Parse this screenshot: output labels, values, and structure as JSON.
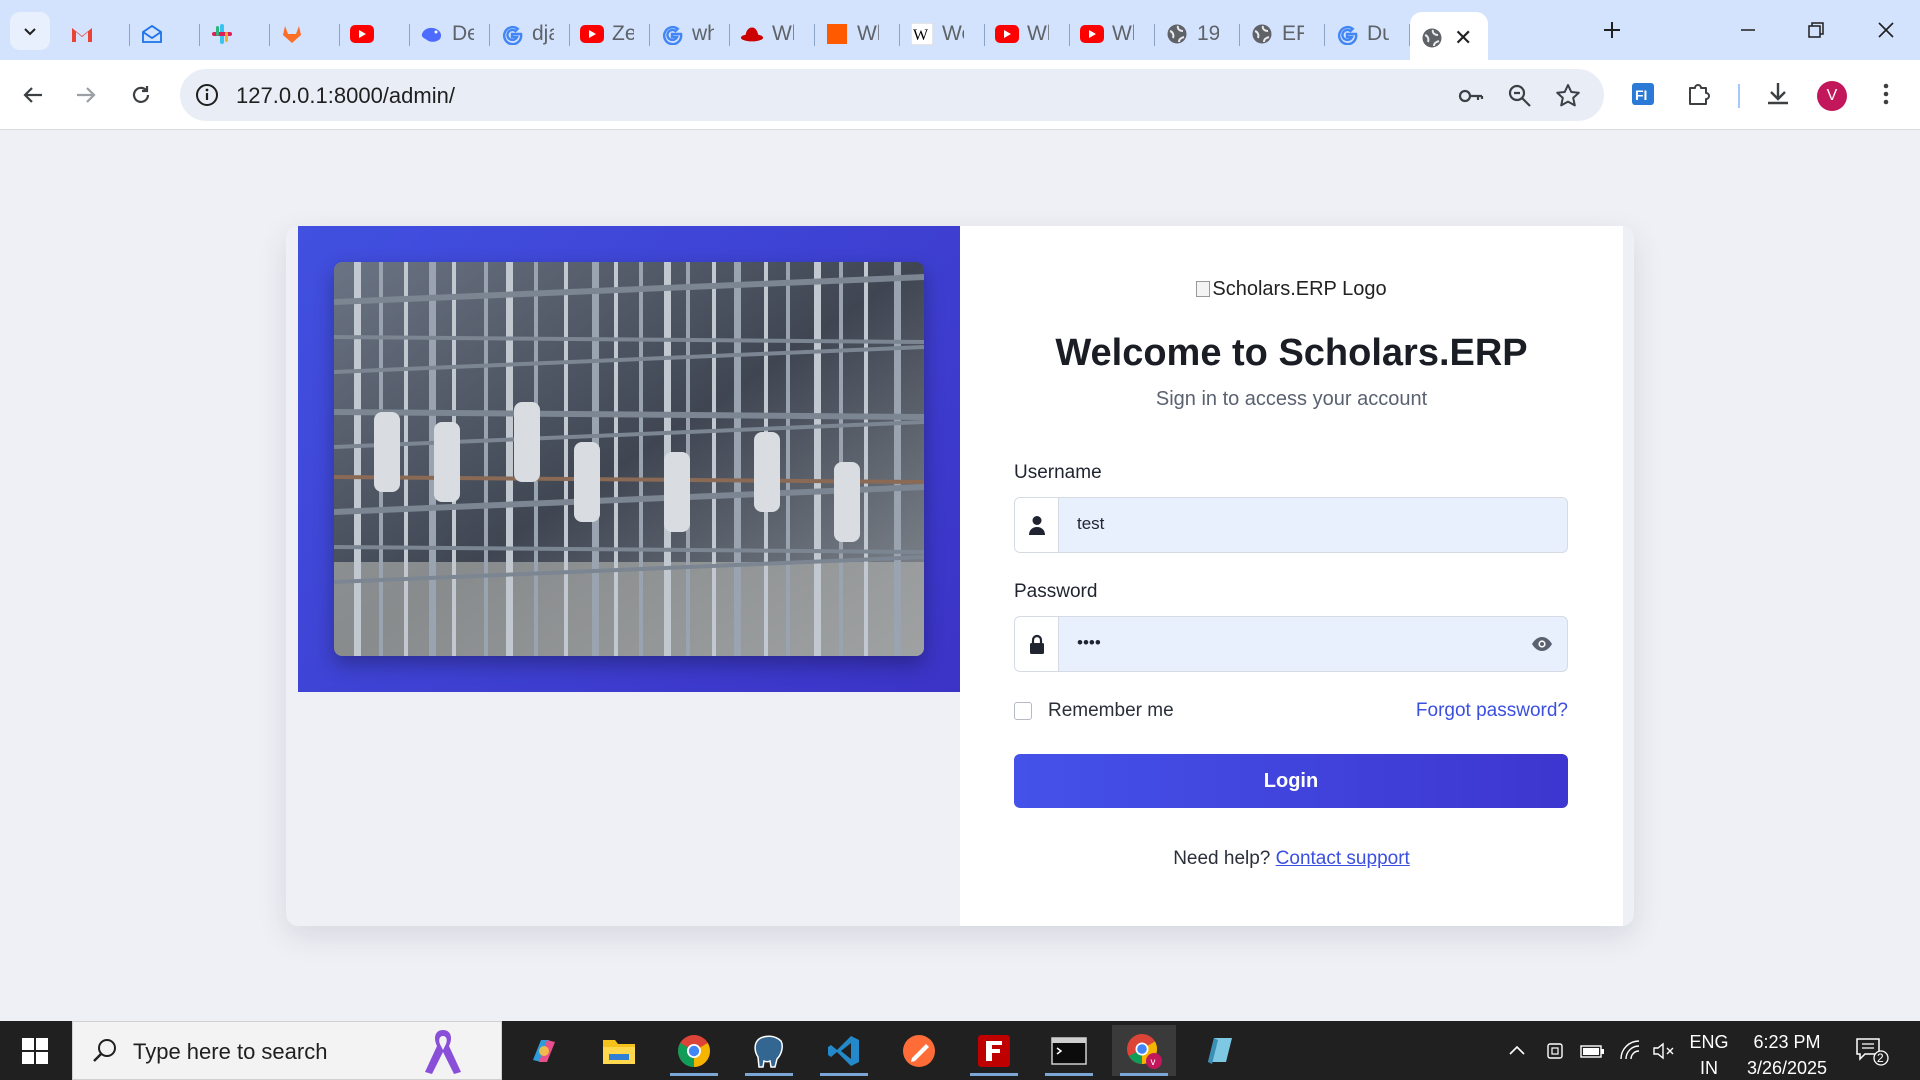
{
  "browser": {
    "tabs": [
      {
        "label": "",
        "icon": "gmail-icon",
        "color": "#ea4335"
      },
      {
        "label": "",
        "icon": "mail-icon",
        "color": "#1a73e8"
      },
      {
        "label": "",
        "icon": "slack-icon",
        "color": "#e01e5a"
      },
      {
        "label": "",
        "icon": "gitlab-icon",
        "color": "#fc6d26"
      },
      {
        "label": "",
        "icon": "youtube-icon",
        "color": "#ff0000"
      },
      {
        "label": "De",
        "icon": "deepseek-icon",
        "color": "#4d6bfe"
      },
      {
        "label": "dja",
        "icon": "google-icon",
        "color": "#4285f4"
      },
      {
        "label": "Ze",
        "icon": "youtube-icon",
        "color": "#ff0000"
      },
      {
        "label": "wh",
        "icon": "google-icon",
        "color": "#4285f4"
      },
      {
        "label": "Wl",
        "icon": "redhat-icon",
        "color": "#cc0000"
      },
      {
        "label": "Wl",
        "icon": "orange-square-icon",
        "color": "#ff5a00"
      },
      {
        "label": "We",
        "icon": "wikipedia-icon",
        "color": "#000000"
      },
      {
        "label": "Wl",
        "icon": "youtube-icon",
        "color": "#ff0000"
      },
      {
        "label": "Wl",
        "icon": "youtube-icon",
        "color": "#ff0000"
      },
      {
        "label": "19",
        "icon": "globe-icon",
        "color": "#5f6368"
      },
      {
        "label": "ER",
        "icon": "globe-icon",
        "color": "#5f6368"
      },
      {
        "label": "Du",
        "icon": "google-icon",
        "color": "#4285f4"
      }
    ],
    "active_tab": {
      "icon": "globe-icon"
    },
    "url": "127.0.0.1:8000/admin/",
    "profile_initial": "V"
  },
  "login": {
    "logo_alt": "Scholars.ERP Logo",
    "title": "Welcome to Scholars.ERP",
    "subtitle": "Sign in to access your account",
    "username_label": "Username",
    "username_value": "test",
    "password_label": "Password",
    "password_value": "••••",
    "remember_label": "Remember me",
    "forgot_label": "Forgot password?",
    "login_button": "Login",
    "help_text": "Need help?",
    "help_link": "Contact support",
    "accent_color": "#4350e6"
  },
  "taskbar": {
    "search_placeholder": "Type here to search",
    "lang_line1": "ENG",
    "lang_line2": "IN",
    "time": "6:23 PM",
    "date": "3/26/2025",
    "notification_count": "2"
  }
}
